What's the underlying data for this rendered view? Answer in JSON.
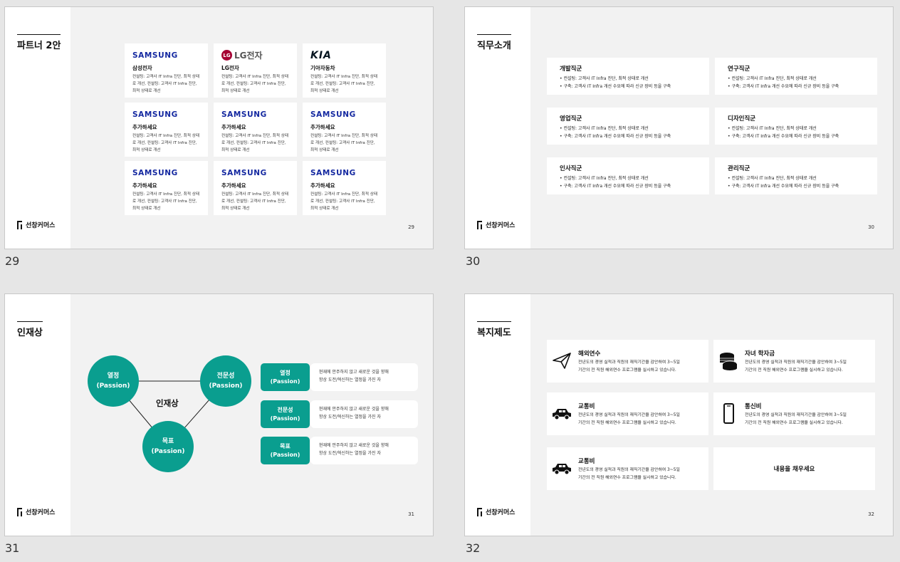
{
  "brand": "선창커머스",
  "slides": {
    "s29": {
      "number": "29",
      "page": "29",
      "title": "파트너 2안",
      "cards": [
        {
          "brand": "SAMSUNG",
          "name": "삼성전자",
          "desc": "컨설팅: 고객사 IT Infra 진단, 최적 상태로 개선, 컨설팅: 고객사 IT Infra 진단, 최적 상태로 개선"
        },
        {
          "brand": "LG전자",
          "name": "LG전자",
          "desc": "컨설팅: 고객사 IT Infra 진단, 최적 상태로 개선, 컨설팅: 고객사 IT Infra 진단, 최적 상태로 개선"
        },
        {
          "brand": "KIA",
          "name": "기아자동차",
          "desc": "컨설팅: 고객사 IT Infra 진단, 최적 상태로 개선, 컨설팅: 고객사 IT Infra 진단, 최적 상태로 개선"
        },
        {
          "brand": "SAMSUNG",
          "name": "추가하세요",
          "desc": "컨설팅: 고객사 IT Infra 진단, 최적 상태로 개선, 컨설팅: 고객사 IT Infra 진단, 최적 상태로 개선"
        },
        {
          "brand": "SAMSUNG",
          "name": "추가하세요",
          "desc": "컨설팅: 고객사 IT Infra 진단, 최적 상태로 개선, 컨설팅: 고객사 IT Infra 진단, 최적 상태로 개선"
        },
        {
          "brand": "SAMSUNG",
          "name": "추가하세요",
          "desc": "컨설팅: 고객사 IT Infra 진단, 최적 상태로 개선, 컨설팅: 고객사 IT Infra 진단, 최적 상태로 개선"
        },
        {
          "brand": "SAMSUNG",
          "name": "추가하세요",
          "desc": "컨설팅: 고객사 IT Infra 진단, 최적 상태로 개선, 컨설팅: 고객사 IT Infra 진단, 최적 상태로 개선"
        },
        {
          "brand": "SAMSUNG",
          "name": "추가하세요",
          "desc": "컨설팅: 고객사 IT Infra 진단, 최적 상태로 개선, 컨설팅: 고객사 IT Infra 진단, 최적 상태로 개선"
        },
        {
          "brand": "SAMSUNG",
          "name": "추가하세요",
          "desc": "컨설팅: 고객사 IT Infra 진단, 최적 상태로 개선, 컨설팅: 고객사 IT Infra 진단, 최적 상태로 개선"
        }
      ]
    },
    "s30": {
      "number": "30",
      "page": "30",
      "title": "직무소개",
      "jobs": [
        {
          "title": "개발직군",
          "line1": "•  컨설팅: 고객사 IT Infra 진단, 최적 상태로 개선",
          "line2": "•  구축: 고객사 IT Infra 개선 수요에 따라 신규 장비 등을 구축"
        },
        {
          "title": "연구직군",
          "line1": "•  컨설팅: 고객사 IT Infra 진단, 최적 상태로 개선",
          "line2": "•  구축: 고객사 IT Infra 개선 수요에 따라 신규 장비 등을 구축"
        },
        {
          "title": "영업직군",
          "line1": "•  컨설팅: 고객사 IT Infra 진단, 최적 상태로 개선",
          "line2": "•  구축: 고객사 IT Infra 개선 수요에 따라 신규 장비 등을 구축"
        },
        {
          "title": "디자인직군",
          "line1": "•  컨설팅: 고객사 IT Infra 진단, 최적 상태로 개선",
          "line2": "•  구축: 고객사 IT Infra 개선 수요에 따라 신규 장비 등을 구축"
        },
        {
          "title": "인사직군",
          "line1": "•  컨설팅: 고객사 IT Infra 진단, 최적 상태로 개선",
          "line2": "•  구축: 고객사 IT Infra 개선 수요에 따라 신규 장비 등을 구축"
        },
        {
          "title": "관리직군",
          "line1": "•  컨설팅: 고객사 IT Infra 진단, 최적 상태로 개선",
          "line2": "•  구축: 고객사 IT Infra 개선 수요에 따라 신규 장비 등을 구축"
        }
      ]
    },
    "s31": {
      "number": "31",
      "page": "31",
      "title": "인재상",
      "center": "인재상",
      "circles": [
        {
          "line1": "열정",
          "line2": "(Passion)"
        },
        {
          "line1": "전문성",
          "line2": "(Passion)"
        },
        {
          "line1": "목표",
          "line2": "(Passion)"
        }
      ],
      "items": [
        {
          "line1": "열정",
          "line2": "(Passion)",
          "desc1": "현재에 안주하지 않고 새로운 것을 향해",
          "desc2": "항상 도전/혁신하는 열정을 가진 자"
        },
        {
          "line1": "전문성",
          "line2": "(Passion)",
          "desc1": "현재에 안주하지 않고 새로운 것을 향해",
          "desc2": "항상 도전/혁신하는 열정을 가진 자"
        },
        {
          "line1": "목표",
          "line2": "(Passion)",
          "desc1": "현재에 안주하지 않고 새로운 것을 향해",
          "desc2": "항상 도전/혁신하는 열정을 가진 자"
        }
      ]
    },
    "s32": {
      "number": "32",
      "page": "32",
      "title": "복지제도",
      "benefits": [
        {
          "icon": "paper-plane-icon",
          "title": "해외연수",
          "line1": "전년도의 경영 실적과 직원의 재직기간을 감안하여 3~5일",
          "line2": "기간의 전 직원 해외연수 프로그램을 실시하고 있습니다."
        },
        {
          "icon": "coins-icon",
          "title": "자녀 학자금",
          "line1": "전년도의 경영 실적과 직원의 재직기간을 감안하여 3~5일",
          "line2": "기간의 전 직원 해외연수 프로그램을 실시하고 있습니다."
        },
        {
          "icon": "car-icon",
          "title": "교통비",
          "line1": "전년도의 경영 실적과 직원의 재직기간을 감안하여 3~5일",
          "line2": "기간의 전 직원 해외연수 프로그램을 실시하고 있습니다."
        },
        {
          "icon": "phone-icon",
          "title": "통신비",
          "line1": "전년도의 경영 실적과 직원의 재직기간을 감안하여 3~5일",
          "line2": "기간의 전 직원 해외연수 프로그램을 실시하고 있습니다."
        },
        {
          "icon": "car-icon",
          "title": "교통비",
          "line1": "전년도의 경영 실적과 직원의 재직기간을 감안하여 3~5일",
          "line2": "기간의 전 직원 해외연수 프로그램을 실시하고 있습니다."
        }
      ],
      "placeholder": "내용을 채우세요"
    }
  }
}
